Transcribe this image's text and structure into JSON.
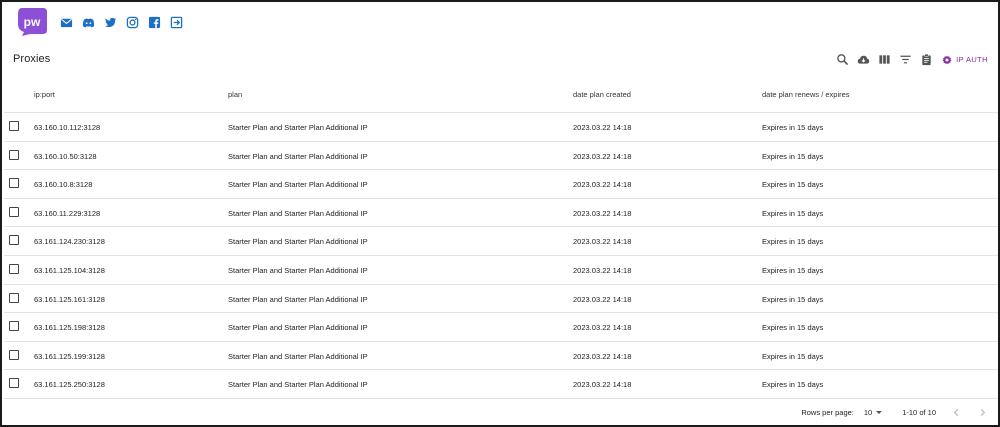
{
  "brand": {
    "logo_text": "pw",
    "logo_color": "#8c4fd6",
    "accent": "#8a2fa3",
    "social_icon_color": "#1c6fc2"
  },
  "social": [
    {
      "name": "mail-icon"
    },
    {
      "name": "discord-icon"
    },
    {
      "name": "twitter-icon"
    },
    {
      "name": "instagram-icon"
    },
    {
      "name": "facebook-icon"
    },
    {
      "name": "logout-icon"
    }
  ],
  "header": {
    "title": "Proxies",
    "toolbar": [
      "search-icon",
      "cloud-download-icon",
      "view-columns-icon",
      "filter-icon",
      "clipboard-icon"
    ],
    "ip_auth_label": "IP AUTH"
  },
  "table": {
    "columns": [
      "ip:port",
      "plan",
      "date plan created",
      "date plan renews / expires"
    ],
    "rows": [
      {
        "ip": "63.160.10.112:3128",
        "plan": "Starter Plan and Starter Plan Additional IP",
        "created": "2023.03.22 14:18",
        "expires": "Expires in 15 days"
      },
      {
        "ip": "63.160.10.50:3128",
        "plan": "Starter Plan and Starter Plan Additional IP",
        "created": "2023.03.22 14:18",
        "expires": "Expires in 15 days"
      },
      {
        "ip": "63.160.10.8:3128",
        "plan": "Starter Plan and Starter Plan Additional IP",
        "created": "2023.03.22 14:18",
        "expires": "Expires in 15 days"
      },
      {
        "ip": "63.160.11.229:3128",
        "plan": "Starter Plan and Starter Plan Additional IP",
        "created": "2023.03.22 14:18",
        "expires": "Expires in 15 days"
      },
      {
        "ip": "63.161.124.230:3128",
        "plan": "Starter Plan and Starter Plan Additional IP",
        "created": "2023.03.22 14:18",
        "expires": "Expires in 15 days"
      },
      {
        "ip": "63.161.125.104:3128",
        "plan": "Starter Plan and Starter Plan Additional IP",
        "created": "2023.03.22 14:18",
        "expires": "Expires in 15 days"
      },
      {
        "ip": "63.161.125.161:3128",
        "plan": "Starter Plan and Starter Plan Additional IP",
        "created": "2023.03.22 14:18",
        "expires": "Expires in 15 days"
      },
      {
        "ip": "63.161.125.198:3128",
        "plan": "Starter Plan and Starter Plan Additional IP",
        "created": "2023.03.22 14:18",
        "expires": "Expires in 15 days"
      },
      {
        "ip": "63.161.125.199:3128",
        "plan": "Starter Plan and Starter Plan Additional IP",
        "created": "2023.03.22 14:18",
        "expires": "Expires in 15 days"
      },
      {
        "ip": "63.161.125.250:3128",
        "plan": "Starter Plan and Starter Plan Additional IP",
        "created": "2023.03.22 14:18",
        "expires": "Expires in 15 days"
      }
    ]
  },
  "pagination": {
    "rows_per_page_label": "Rows per page:",
    "rows_per_page_value": "10",
    "range_label": "1-10 of 10"
  }
}
